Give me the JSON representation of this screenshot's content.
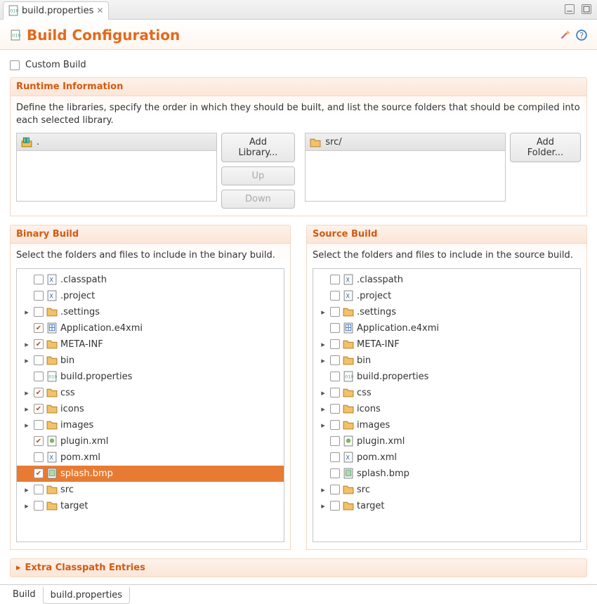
{
  "tab": {
    "filename": "build.properties"
  },
  "header": {
    "title": "Build Configuration"
  },
  "customBuild": {
    "label": "Custom Build",
    "checked": false
  },
  "runtime": {
    "title": "Runtime Information",
    "desc": "Define the libraries, specify the order in which they should be built, and list the source folders that should be compiled into each selected library.",
    "libraryList": {
      "headerLabel": "."
    },
    "folderList": {
      "headerLabel": "src/"
    },
    "buttons": {
      "addLibrary": "Add Library...",
      "up": "Up",
      "down": "Down",
      "addFolder": "Add Folder..."
    }
  },
  "binaryBuild": {
    "title": "Binary Build",
    "desc": "Select the folders and files to include in the binary build.",
    "items": [
      {
        "label": ".classpath",
        "checked": false,
        "expandable": false,
        "type": "xfile"
      },
      {
        "label": ".project",
        "checked": false,
        "expandable": false,
        "type": "xfile"
      },
      {
        "label": ".settings",
        "checked": false,
        "expandable": true,
        "type": "folder"
      },
      {
        "label": "Application.e4xmi",
        "checked": true,
        "expandable": false,
        "type": "gridfile"
      },
      {
        "label": "META-INF",
        "checked": true,
        "expandable": true,
        "type": "folder"
      },
      {
        "label": "bin",
        "checked": false,
        "expandable": true,
        "type": "folder"
      },
      {
        "label": "build.properties",
        "checked": false,
        "expandable": false,
        "type": "propfile"
      },
      {
        "label": "css",
        "checked": true,
        "expandable": true,
        "type": "folder"
      },
      {
        "label": "icons",
        "checked": true,
        "expandable": true,
        "type": "folder"
      },
      {
        "label": "images",
        "checked": false,
        "expandable": true,
        "type": "folder"
      },
      {
        "label": "plugin.xml",
        "checked": true,
        "expandable": false,
        "type": "plugfile"
      },
      {
        "label": "pom.xml",
        "checked": false,
        "expandable": false,
        "type": "xfile"
      },
      {
        "label": "splash.bmp",
        "checked": true,
        "expandable": false,
        "type": "imgfile",
        "selected": true
      },
      {
        "label": "src",
        "checked": false,
        "expandable": true,
        "type": "folder"
      },
      {
        "label": "target",
        "checked": false,
        "expandable": true,
        "type": "folder"
      }
    ]
  },
  "sourceBuild": {
    "title": "Source Build",
    "desc": "Select the folders and files to include in the source build.",
    "items": [
      {
        "label": ".classpath",
        "checked": false,
        "expandable": false,
        "type": "xfile"
      },
      {
        "label": ".project",
        "checked": false,
        "expandable": false,
        "type": "xfile"
      },
      {
        "label": ".settings",
        "checked": false,
        "expandable": true,
        "type": "folder"
      },
      {
        "label": "Application.e4xmi",
        "checked": false,
        "expandable": false,
        "type": "gridfile"
      },
      {
        "label": "META-INF",
        "checked": false,
        "expandable": true,
        "type": "folder"
      },
      {
        "label": "bin",
        "checked": false,
        "expandable": true,
        "type": "folder"
      },
      {
        "label": "build.properties",
        "checked": false,
        "expandable": false,
        "type": "propfile"
      },
      {
        "label": "css",
        "checked": false,
        "expandable": true,
        "type": "folder"
      },
      {
        "label": "icons",
        "checked": false,
        "expandable": true,
        "type": "folder"
      },
      {
        "label": "images",
        "checked": false,
        "expandable": true,
        "type": "folder"
      },
      {
        "label": "plugin.xml",
        "checked": false,
        "expandable": false,
        "type": "plugfile"
      },
      {
        "label": "pom.xml",
        "checked": false,
        "expandable": false,
        "type": "xfile"
      },
      {
        "label": "splash.bmp",
        "checked": false,
        "expandable": false,
        "type": "imgfile"
      },
      {
        "label": "src",
        "checked": false,
        "expandable": true,
        "type": "folder"
      },
      {
        "label": "target",
        "checked": false,
        "expandable": true,
        "type": "folder"
      }
    ]
  },
  "extra": {
    "title": "Extra Classpath Entries"
  },
  "bottomTabs": {
    "tab1": "Build",
    "tab2": "build.properties"
  }
}
